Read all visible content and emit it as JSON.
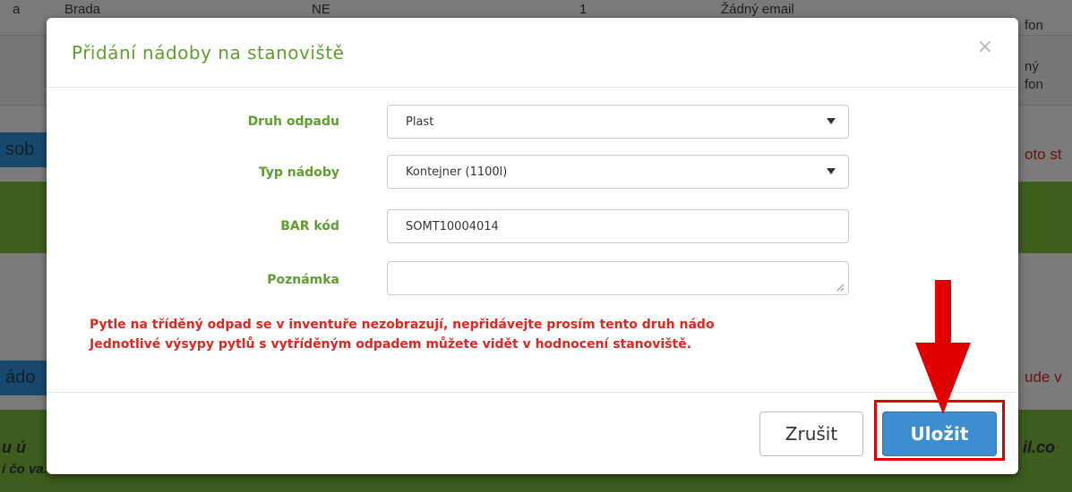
{
  "background": {
    "top_row": {
      "cells": [
        "a",
        "Brada",
        "NE",
        "1",
        "Žádný email"
      ]
    },
    "right_fragments": [
      "fon",
      "ný",
      "fon",
      "oto st",
      "ude v",
      "il.co"
    ],
    "left_fragments": [
      "sob",
      "ádo",
      "u ú",
      "í čo va."
    ]
  },
  "modal": {
    "title": "Přidání nádoby na stanoviště",
    "close_glyph": "×",
    "fields": {
      "waste_type": {
        "label": "Druh odpadu",
        "value": "Plast"
      },
      "container_type": {
        "label": "Typ nádoby",
        "value": "Kontejner (1100l)"
      },
      "bar_code": {
        "label": "BAR kód",
        "value": "SOMT10004014"
      },
      "note": {
        "label": "Poznámka",
        "value": ""
      }
    },
    "warning": {
      "line1": "Pytle na tříděný odpad se v inventuře nezobrazují, nepřidávejte prosím tento druh nádo",
      "line2": "Jednotlivé výsypy pytlů s vytříděným odpadem můžete vidět v hodnocení stanoviště."
    },
    "footer": {
      "cancel_label": "Zrušit",
      "save_label": "Uložit"
    }
  },
  "colors": {
    "title_green": "#5e9e2c",
    "warning_red": "#e1261e",
    "save_blue": "#3d8dcf",
    "annotation_red": "#e00000"
  }
}
